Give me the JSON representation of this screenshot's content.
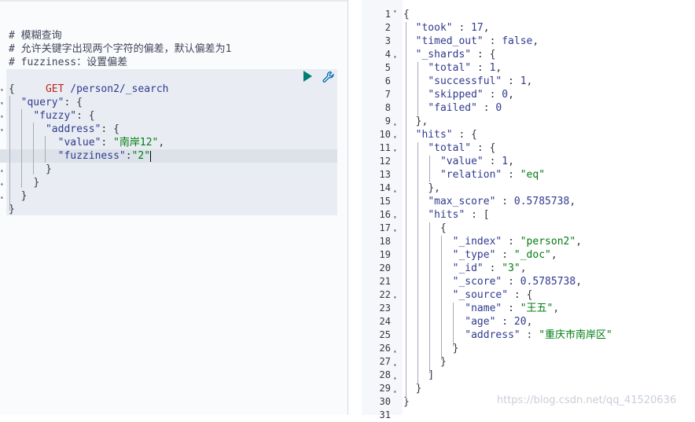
{
  "console": {
    "comments": [
      "# 模糊查询",
      "# 允许关键字出现两个字符的偏差，默认偏差为1",
      "# fuzziness：设置偏差"
    ],
    "request_method": "GET",
    "request_url": "/person2/_search",
    "request_body": [
      "{",
      "  \"query\": {",
      "    \"fuzzy\": {",
      "      \"address\": {",
      "        \"value\": \"南岸12\",",
      "        \"fuzziness\":\"2\"",
      "      }",
      "    }",
      "  }",
      "}"
    ],
    "run_icon": "play-icon",
    "settings_icon": "wrench-icon"
  },
  "response": {
    "line_numbers": [
      "1",
      "2",
      "3",
      "4",
      "5",
      "6",
      "7",
      "8",
      "9",
      "10",
      "11",
      "12",
      "13",
      "14",
      "15",
      "16",
      "17",
      "18",
      "19",
      "20",
      "21",
      "22",
      "23",
      "24",
      "25",
      "26",
      "27",
      "28",
      "29",
      "30",
      "31"
    ],
    "lines": [
      "{",
      "  \"took\" : 17,",
      "  \"timed_out\" : false,",
      "  \"_shards\" : {",
      "    \"total\" : 1,",
      "    \"successful\" : 1,",
      "    \"skipped\" : 0,",
      "    \"failed\" : 0",
      "  },",
      "  \"hits\" : {",
      "    \"total\" : {",
      "      \"value\" : 1,",
      "      \"relation\" : \"eq\"",
      "    },",
      "    \"max_score\" : 0.5785738,",
      "    \"hits\" : [",
      "      {",
      "        \"_index\" : \"person2\",",
      "        \"_type\" : \"_doc\",",
      "        \"_id\" : \"3\",",
      "        \"_score\" : 0.5785738,",
      "        \"_source\" : {",
      "          \"name\" : \"王五\",",
      "          \"age\" : 20,",
      "          \"address\" : \"重庆市南岸区\"",
      "        }",
      "      }",
      "    ]",
      "  }",
      "}",
      ""
    ]
  },
  "watermark": "https://blog.csdn.net/qq_41520636"
}
